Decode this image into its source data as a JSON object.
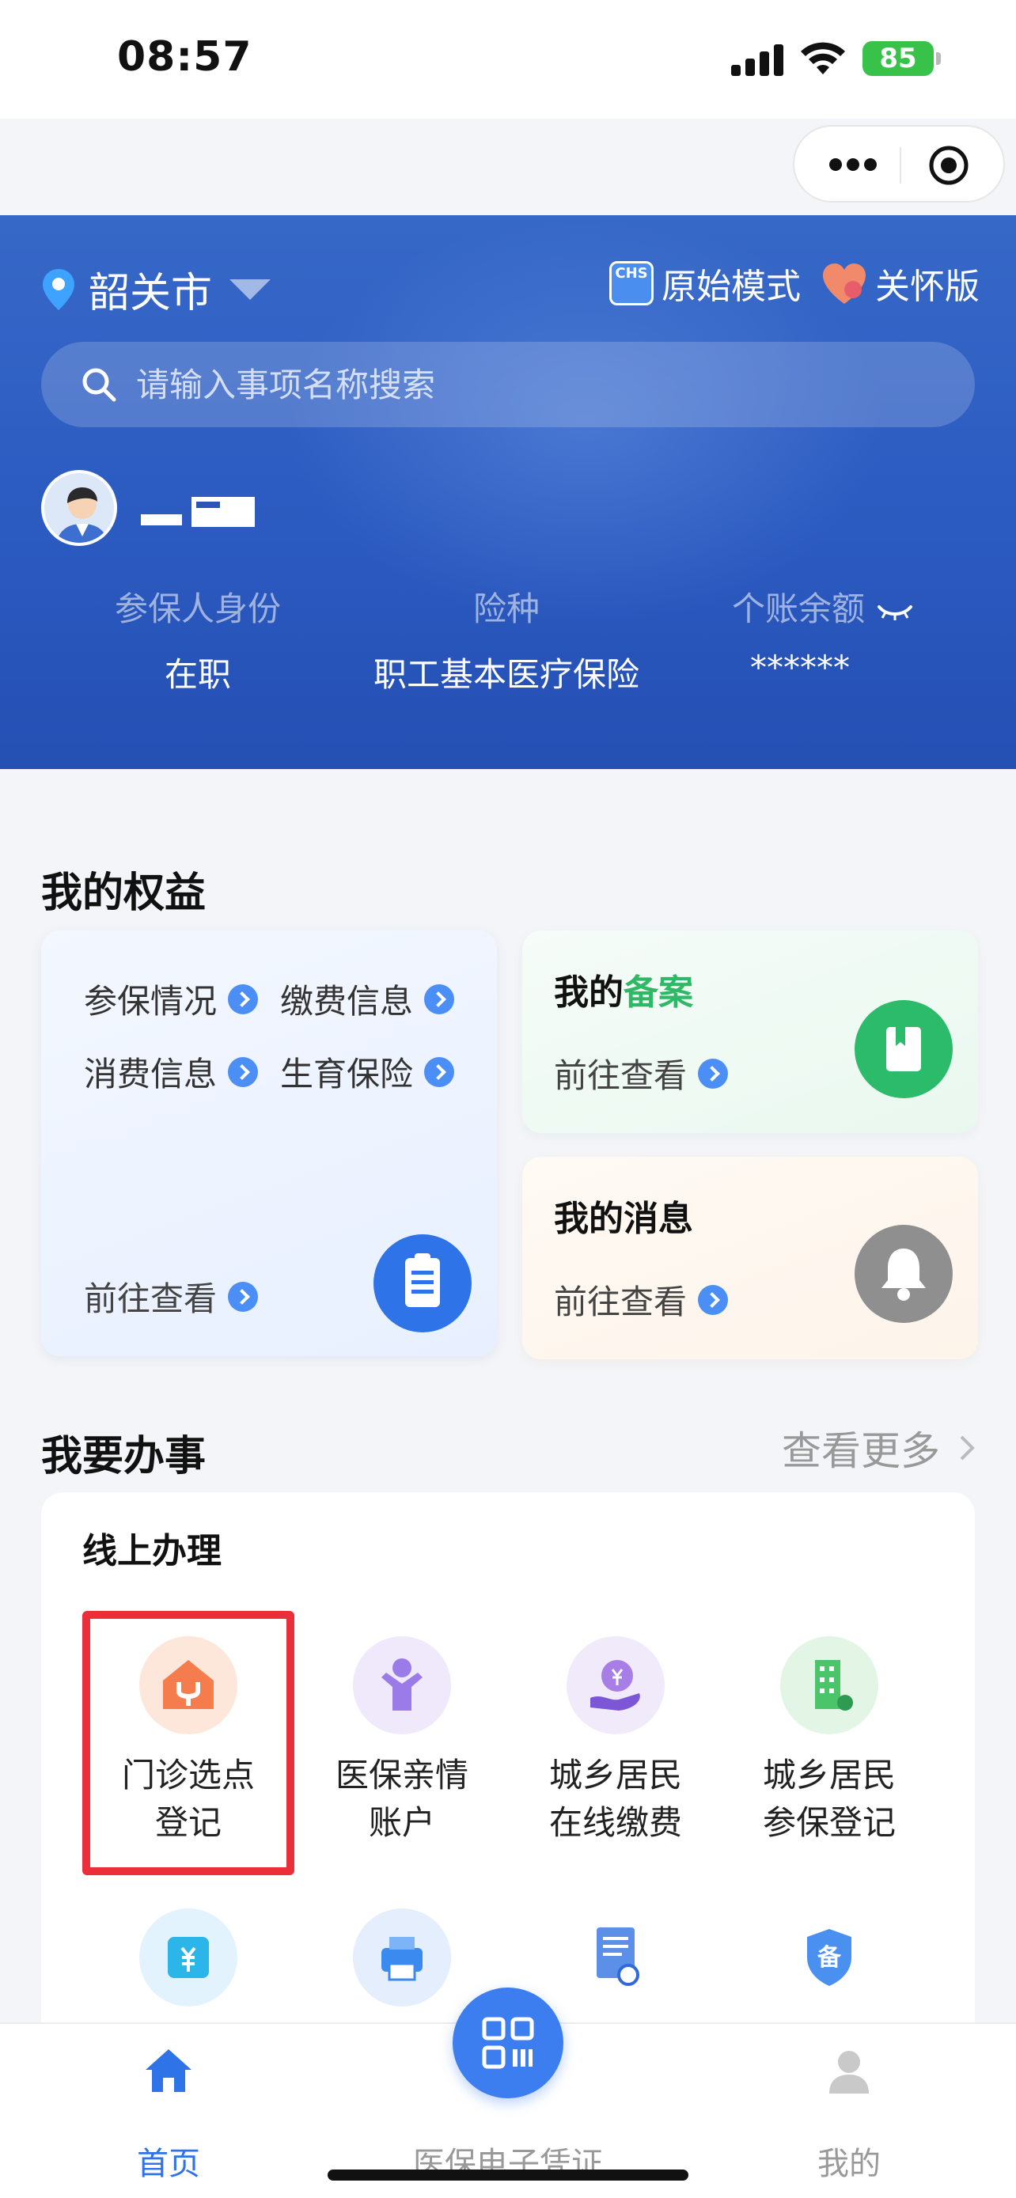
{
  "status_bar": {
    "time": "08:57",
    "battery": "85"
  },
  "header": {
    "city": "韶关市",
    "mode_original": "原始模式",
    "mode_care": "关怀版",
    "chs_badge": "CHS",
    "search_placeholder": "请输入事项名称搜索"
  },
  "profile": {
    "fields": [
      {
        "label": "参保人身份",
        "value": "在职"
      },
      {
        "label": "险种",
        "value": "职工基本医疗保险"
      },
      {
        "label": "个账余额",
        "value": "******"
      }
    ]
  },
  "benefits": {
    "title": "我的权益",
    "links": [
      "参保情况",
      "缴费信息",
      "消费信息",
      "生育保险"
    ],
    "go_label": "前往查看",
    "filing_title_prefix": "我的",
    "filing_title_accent": "备案",
    "filing_go": "前往查看",
    "messages_title": "我的消息",
    "messages_go": "前往查看"
  },
  "services": {
    "title": "我要办事",
    "see_more": "查看更多",
    "panel_title": "线上办理",
    "items": [
      {
        "line1": "门诊选点",
        "line2": "登记",
        "icon": "clinic-house-icon"
      },
      {
        "line1": "医保亲情",
        "line2": "账户",
        "icon": "family-account-icon"
      },
      {
        "line1": "城乡居民",
        "line2": "在线缴费",
        "icon": "online-payment-icon"
      },
      {
        "line1": "城乡居民",
        "line2": "参保登记",
        "icon": "enrollment-building-icon"
      }
    ],
    "row2_icons": [
      "wallet-yuan-icon",
      "printer-icon",
      "document-search-icon"
    ],
    "row2_badge": "备"
  },
  "tabbar": {
    "home": "首页",
    "voucher": "医保电子凭证",
    "me": "我的"
  },
  "colors": {
    "brand_blue": "#2b5ac0",
    "accent_green": "#2fb866",
    "highlight_red": "#ea2e3a"
  }
}
